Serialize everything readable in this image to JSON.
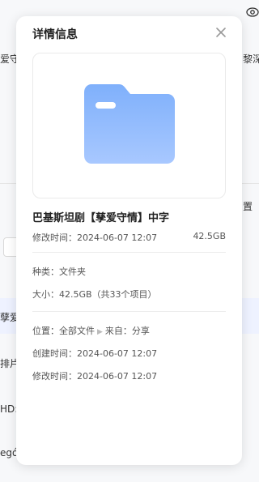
{
  "background": {
    "left_texts": [
      "爱守情",
      "孽爱",
      "排片",
      "HD:",
      "egó"
    ],
    "right_texts": [
      "黎深",
      "置"
    ]
  },
  "panel": {
    "title": "详情信息",
    "file_name": "巴基斯坦剧【孳爱守情】中字",
    "modified_label": "修改时间：2024-06-07 12:07",
    "size_short": "42.5GB",
    "type_label": "种类：文件夹",
    "size_label": "大小：42.5GB（共33个项目）",
    "location_prefix": "位置：",
    "location_path": "全部文件",
    "source_prefix": "来自：",
    "source_value": "分享",
    "created_label": "创建时间：2024-06-07 12:07",
    "modified_label_2": "修改时间：2024-06-07 12:07"
  },
  "icons": {
    "close": "close-icon",
    "folder": "folder-icon",
    "arrow": "chevron-right-icon",
    "eye": "eye-icon"
  },
  "colors": {
    "folder_top": "#7fb0fb",
    "folder_bottom": "#a8c8ff",
    "highlight_row": "#eef2ff"
  }
}
